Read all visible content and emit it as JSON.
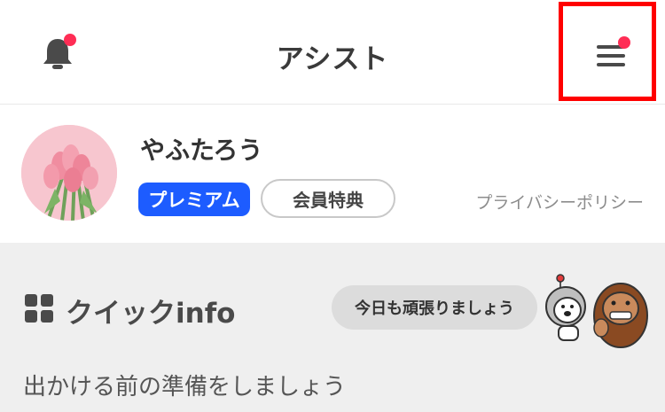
{
  "header": {
    "title": "アシスト",
    "notification_icon": "bell-icon",
    "menu_icon": "hamburger-menu-icon",
    "badge_color": "#ff2d55",
    "highlight_color": "#ff0000"
  },
  "profile": {
    "username": "やふたろう",
    "premium_label": "プレミアム",
    "perks_label": "会員特典",
    "privacy_label": "プライバシーポリシー",
    "premium_color": "#1d5cff"
  },
  "quick_info": {
    "title": "クイックinfo",
    "cheer_text": "今日も頑張りましょう",
    "prepare_text": "出かける前の準備をしましょう"
  }
}
